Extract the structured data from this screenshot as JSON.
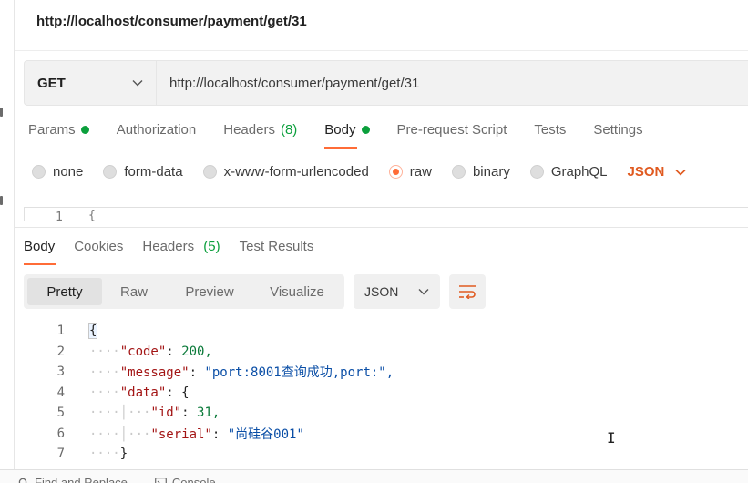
{
  "request": {
    "title": "http://localhost/consumer/payment/get/31",
    "method": "GET",
    "url": "http://localhost/consumer/payment/get/31"
  },
  "request_tabs": [
    {
      "label": "Params"
    },
    {
      "label": "Authorization"
    },
    {
      "label": "Headers",
      "count": "(8)"
    },
    {
      "label": "Body"
    },
    {
      "label": "Pre-request Script"
    },
    {
      "label": "Tests"
    },
    {
      "label": "Settings"
    }
  ],
  "body_modes": [
    {
      "label": "none"
    },
    {
      "label": "form-data"
    },
    {
      "label": "x-www-form-urlencoded"
    },
    {
      "label": "raw"
    },
    {
      "label": "binary"
    },
    {
      "label": "GraphQL"
    }
  ],
  "body_language": "JSON",
  "editor_peek": {
    "line": "1",
    "text": "{"
  },
  "response_tabs": [
    {
      "label": "Body"
    },
    {
      "label": "Cookies"
    },
    {
      "label": "Headers",
      "count": "(5)"
    },
    {
      "label": "Test Results"
    }
  ],
  "view_modes": [
    "Pretty",
    "Raw",
    "Preview",
    "Visualize"
  ],
  "response_format": "JSON",
  "response_lines": [
    {
      "n": "1",
      "text": "{"
    },
    {
      "n": "2",
      "key": "\"code\"",
      "value": "200,"
    },
    {
      "n": "3",
      "key": "\"message\"",
      "value": "\"port:8001查询成功,port:\","
    },
    {
      "n": "4",
      "key": "\"data\"",
      "value": "{"
    },
    {
      "n": "5",
      "key": "\"id\"",
      "value": "31,"
    },
    {
      "n": "6",
      "key": "\"serial\"",
      "value": "\"尚硅谷001\""
    },
    {
      "n": "7",
      "text": "}"
    }
  ],
  "status_bar": {
    "find_replace": "Find and Replace",
    "console": "Console"
  },
  "colors": {
    "accent": "#ff6c37",
    "green_indicator": "#0b9f3c",
    "json_key": "#a31515",
    "json_string": "#0a4ea6",
    "json_number": "#0b7a3a"
  },
  "icons": {
    "method_dropdown": "chevron-down-icon",
    "language_dropdown": "chevron-down-icon",
    "format_dropdown": "chevron-down-icon",
    "wrap": "wrap-lines-icon",
    "find": "search-icon",
    "console": "console-icon"
  }
}
